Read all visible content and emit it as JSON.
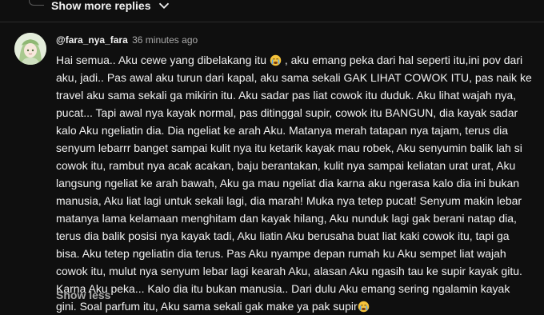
{
  "replies_toggle": {
    "label": "Show more replies",
    "icon": "chevron-down-icon"
  },
  "comment": {
    "author": "@fara_nya_fara",
    "time": "36 minutes ago",
    "text_parts": [
      "Hai semua.. Aku cewe yang dibelakang itu ",
      " , aku emang peka dari hal seperti itu,ini pov dari aku, jadi.. Pas awal aku turun dari kapal, aku sama sekali GAK LIHAT COWOK ITU, pas naik ke travel aku sama sekali ga mikirin itu. Aku sadar pas liat cowok itu duduk. Aku lihat wajah nya, pucat... Tapi awal nya kayak normal, pas ditinggal supir, cowok itu BANGUN, dia kayak sadar kalo Aku ngeliatin dia. Dia ngeliat ke arah Aku. Matanya merah tatapan nya tajam, terus dia senyum lebarrr banget sampai kulit nya itu ketarik kayak mau robek, Aku senyumin balik lah si cowok itu, rambut nya acak acakan, baju berantakan, kulit nya sampai keliatan urat urat, Aku langsung ngeliat ke arah bawah, Aku ga mau ngeliat dia karna aku ngerasa kalo dia ini bukan manusia, Aku liat lagi untuk sekali lagi, dia marah! Muka nya tetep pucat! Senyum makin lebar matanya lama kelamaan menghitam dan kayak hilang, Aku nunduk lagi gak berani natap dia, terus dia balik posisi nya kayak tadi, Aku liatin Aku berusaha buat liat kaki cowok itu, tapi ga bisa. Aku tetep ngeliatin dia terus. Pas Aku nyampe depan rumah ku Aku sempet liat wajah cowok itu, mulut nya senyum lebar lagi kearah Aku, alasan Aku ngasih tau ke supir kayak gitu. Karna Aku peka... Kalo dia itu bukan manusia.. Dari dulu Aku emang sering ngalamin kayak gini. Soal parfum itu, Aku sama sekali gak make ya pak supir"
    ],
    "emoji_icon": "crying-face-icon",
    "show_less": "Show less"
  },
  "colors": {
    "background": "#0f0f0f",
    "text": "#f1f1f1",
    "secondary": "#aaaaaa"
  }
}
